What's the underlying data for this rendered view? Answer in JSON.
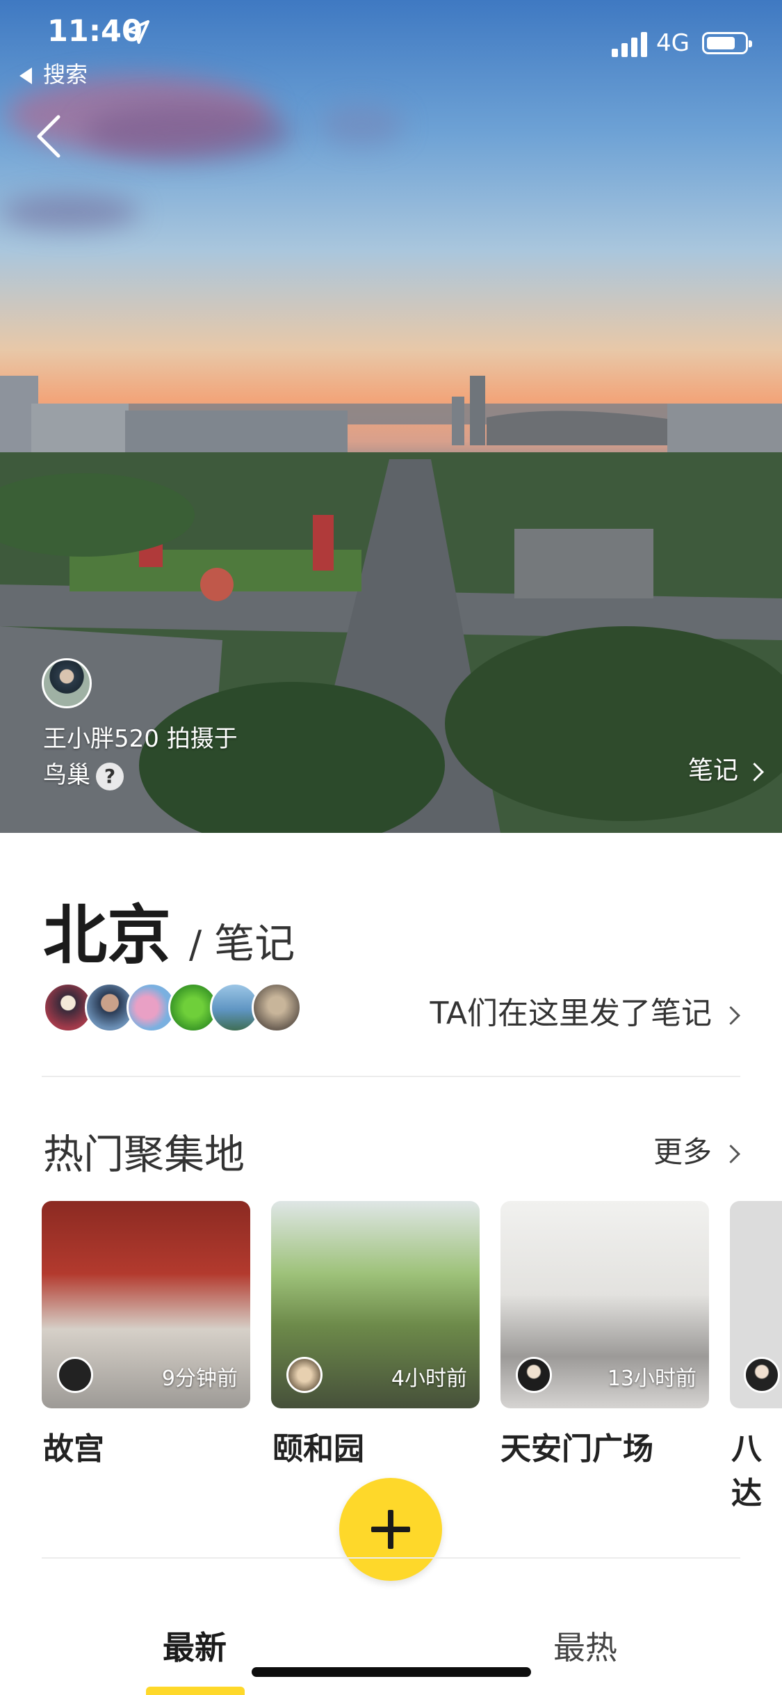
{
  "status_bar": {
    "time": "11:40",
    "back_app": "搜索",
    "network": "4G"
  },
  "hero": {
    "author_caption": "王小胖520 拍摄于",
    "location": "鸟巢",
    "help_icon": "?",
    "notes_link": "笔记"
  },
  "header": {
    "city": "北京",
    "separator": "/",
    "subtitle": "笔记",
    "posted_text": "TA们在这里发了笔记"
  },
  "hot_spots": {
    "title": "热门聚集地",
    "more_label": "更多",
    "cards": [
      {
        "name": "故宫",
        "time": "9分钟前"
      },
      {
        "name": "颐和园",
        "time": "4小时前"
      },
      {
        "name": "天安门广场",
        "time": "13小时前"
      },
      {
        "name": "八达",
        "time": ""
      }
    ]
  },
  "tabs": {
    "latest": "最新",
    "hottest": "最热"
  },
  "colors": {
    "accent": "#fed82a",
    "text_primary": "#1b1b1b",
    "divider": "#ececec"
  },
  "icons": {
    "back": "chevron-left-icon",
    "location": "location-arrow-icon",
    "fab": "plus-icon"
  }
}
